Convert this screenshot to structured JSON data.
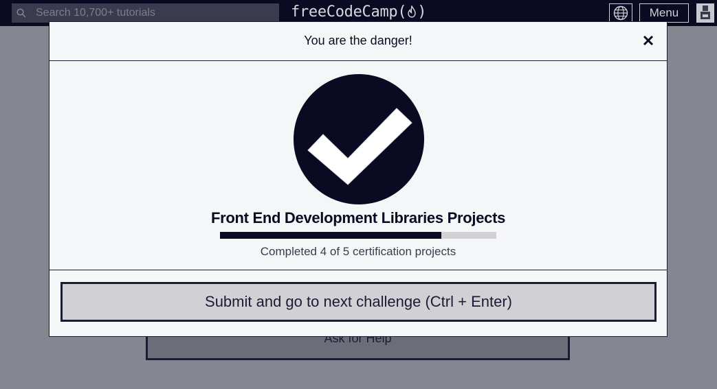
{
  "navbar": {
    "search_placeholder": "Search 10,700+ tutorials",
    "logo_text_left": "freeCodeCamp(",
    "logo_text_right": ")",
    "logo_icon": "flame-icon",
    "language_icon": "globe-icon",
    "menu_label": "Menu",
    "avatar_icon": "user-avatar-icon"
  },
  "background": {
    "ask_help_label": "Ask for Help"
  },
  "modal": {
    "title": "You are the danger!",
    "close_icon": "close-icon",
    "success_icon": "checkmark-circle-icon",
    "cert_title": "Front End Development Libraries Projects",
    "progress": {
      "completed": 4,
      "total": 5,
      "fraction": 0.8
    },
    "progress_caption": "Completed 4 of 5 certification projects",
    "submit_label": "Submit and go to next challenge (Ctrl + Enter)"
  },
  "colors": {
    "nav_bg": "#0a0a23",
    "overlay_bg": "#858690",
    "modal_bg": "#f5f6f7",
    "button_bg": "#d0d0d5",
    "dark": "#0a0a23"
  }
}
